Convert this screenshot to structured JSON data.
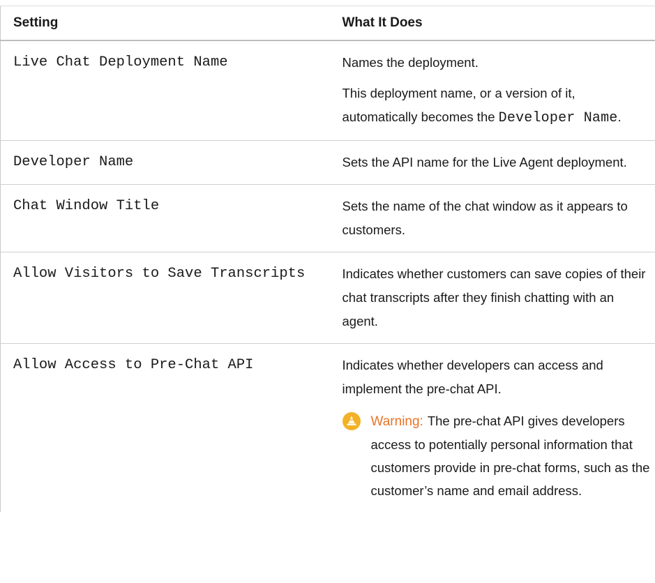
{
  "table": {
    "headers": {
      "setting": "Setting",
      "what": "What It Does"
    },
    "rows": [
      {
        "setting": "Live Chat Deployment Name",
        "desc1": "Names the deployment.",
        "desc2_before": "This deployment name, or a version of it, automatically becomes the",
        "desc2_code": "Developer Name",
        "desc2_after": "."
      },
      {
        "setting": "Developer Name",
        "desc": "Sets the API name for the Live Agent deployment."
      },
      {
        "setting": "Chat Window Title",
        "desc": "Sets the name of the chat window as it appears to customers."
      },
      {
        "setting": "Allow Visitors to Save Transcripts",
        "desc": "Indicates whether customers can save copies of their chat transcripts after they finish chatting with an agent."
      },
      {
        "setting": "Allow Access to Pre-Chat API",
        "desc": "Indicates whether developers can access and implement the pre-chat API.",
        "warning_label": "Warning:",
        "warning_text": "The pre-chat API gives developers access to potentially personal information that customers provide in pre-chat forms, such as the customer’s name and email address."
      }
    ]
  },
  "icons": {
    "warning": "warning-cone-icon"
  },
  "colors": {
    "warning_label": "#e97426",
    "warning_icon": "#f4b127"
  }
}
